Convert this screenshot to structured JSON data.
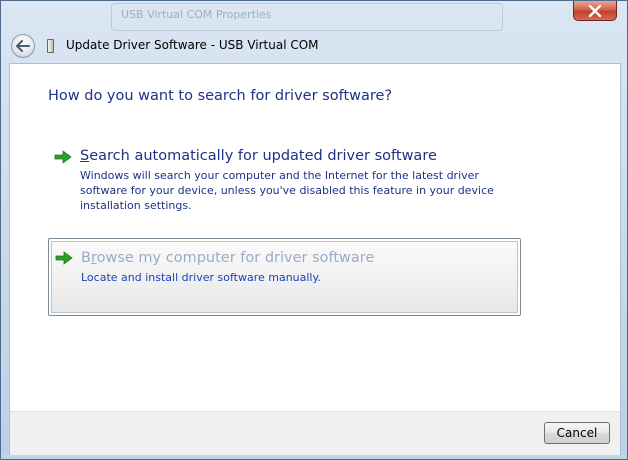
{
  "window": {
    "title": "Update Driver Software - USB Virtual COM",
    "background_title": "USB Virtual COM Properties"
  },
  "content": {
    "heading": "How do you want to search for driver software?",
    "options": [
      {
        "mnemonic": "S",
        "title_rest": "earch automatically for updated driver software",
        "description": "Windows will search your computer and the Internet for the latest driver software for your device, unless you've disabled this feature in your device installation settings."
      },
      {
        "title_first": "B",
        "mnemonic": "r",
        "title_rest": "owse my computer for driver software",
        "description": "Locate and install driver software manually."
      }
    ]
  },
  "footer": {
    "cancel_label": "Cancel"
  },
  "colors": {
    "heading": "#1e3287",
    "link_text": "#1a44b8",
    "hover_title": "#9aabc8",
    "arrow_green": "#2aa12a",
    "close_red": "#c0412a"
  },
  "icons": {
    "close": "close-icon",
    "back": "back-arrow-icon",
    "device": "usb-device-icon",
    "option_arrow": "green-arrow-icon"
  }
}
